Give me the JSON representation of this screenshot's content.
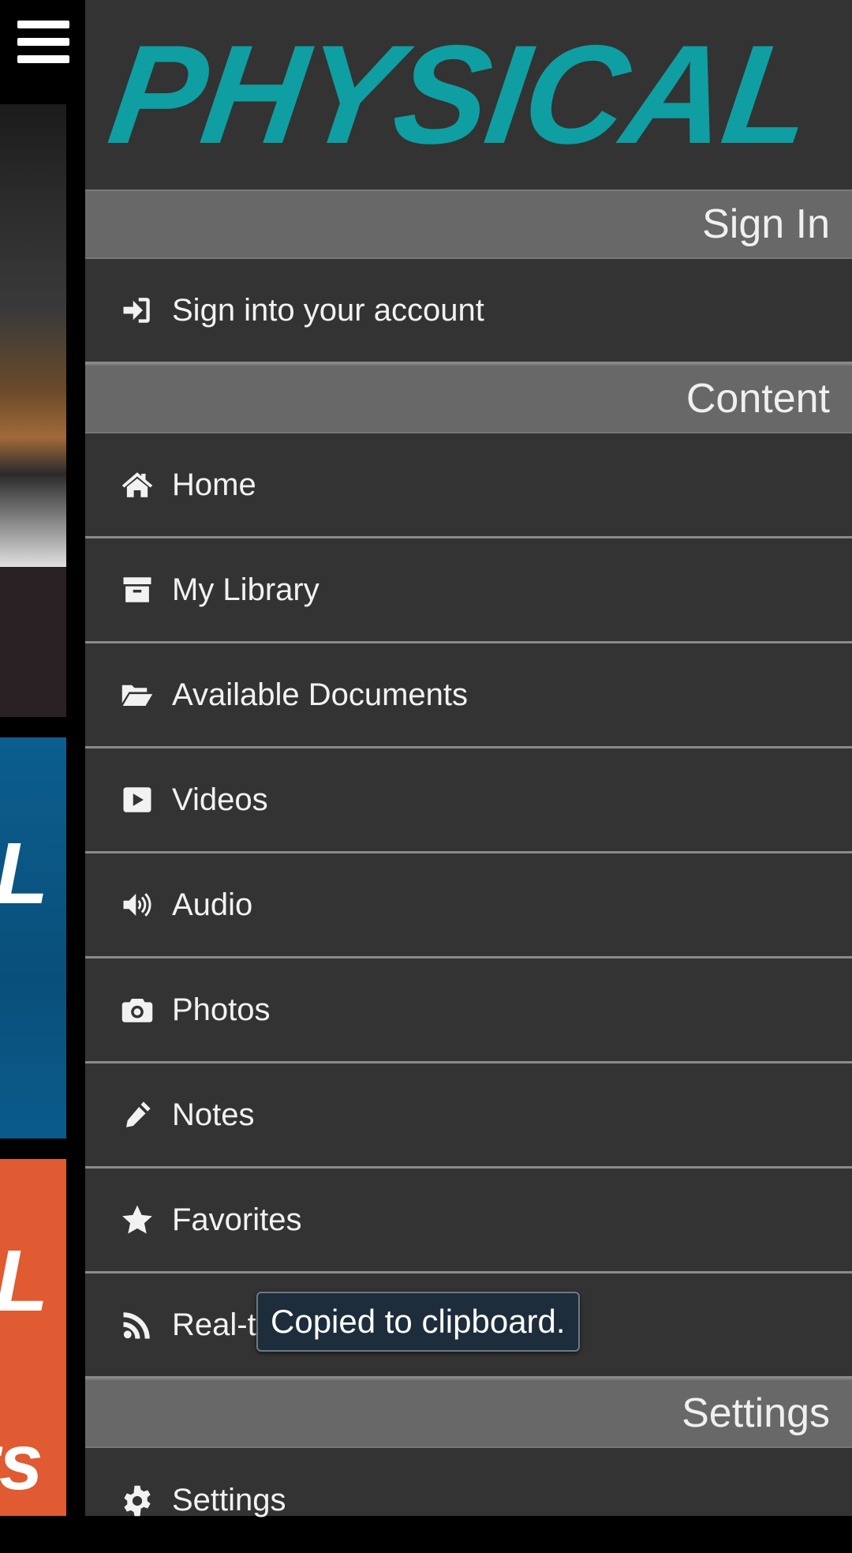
{
  "logo": {
    "text": "PHYSICAL",
    "color": "#0f9ea2"
  },
  "sections": {
    "sign_in": {
      "header": "Sign In",
      "items": [
        {
          "label": "Sign into your account",
          "icon": "sign-in-icon"
        }
      ]
    },
    "content": {
      "header": "Content",
      "items": [
        {
          "label": "Home",
          "icon": "home-icon"
        },
        {
          "label": "My Library",
          "icon": "archive-icon"
        },
        {
          "label": "Available Documents",
          "icon": "folder-open-icon"
        },
        {
          "label": "Videos",
          "icon": "play-icon"
        },
        {
          "label": "Audio",
          "icon": "speaker-icon"
        },
        {
          "label": "Photos",
          "icon": "camera-icon"
        },
        {
          "label": "Notes",
          "icon": "pencil-icon"
        },
        {
          "label": "Favorites",
          "icon": "star-icon"
        },
        {
          "label": "Real-time Content",
          "icon": "rss-icon"
        }
      ]
    },
    "settings": {
      "header": "Settings",
      "items": [
        {
          "label": "Settings",
          "icon": "gear-icon"
        }
      ]
    }
  },
  "toast": {
    "message": "Copied to clipboard."
  },
  "background": {
    "strip_blue_letter": "L",
    "strip_orange_letter_1": "L",
    "strip_orange_letter_2": "rs"
  }
}
